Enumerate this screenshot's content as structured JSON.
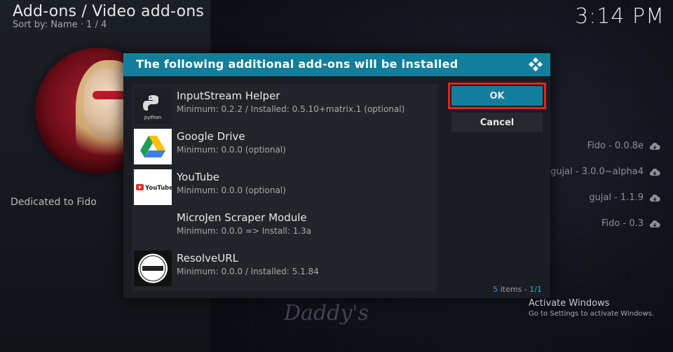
{
  "header": {
    "breadcrumb": "Add-ons / Video add-ons",
    "sort": "Sort by: Name  ·  1 / 4",
    "clock": "3:14 PM"
  },
  "left": {
    "dedicated": "Dedicated to Fido"
  },
  "right_list": [
    {
      "label": "Fido - 0.0.8e"
    },
    {
      "label": "gujal - 3.0.0~alpha4"
    },
    {
      "label": "gujal - 1.1.9"
    },
    {
      "label": "Fido - 0.3"
    }
  ],
  "dialog": {
    "title": "The following additional add-ons will be installed",
    "items": [
      {
        "name": "InputStream Helper",
        "meta": "Minimum: 0.2.2 / Installed: 0.5.10+matrix.1 (optional)",
        "thumb_label": "python"
      },
      {
        "name": "Google Drive",
        "meta": "Minimum: 0.0.0 (optional)"
      },
      {
        "name": "YouTube",
        "meta": "Minimum: 0.0.0 (optional)",
        "thumb_label": "YouTube"
      },
      {
        "name": "MicroJen Scraper Module",
        "meta": "Minimum: 0.0.0 => Install: 1.3a"
      },
      {
        "name": "ResolveURL",
        "meta": "Minimum: 0.0.0 / Installed: 5.1.84"
      }
    ],
    "ok_label": "OK",
    "cancel_label": "Cancel",
    "count_num": "5",
    "count_rest": " items - ",
    "count_page": "1/1"
  },
  "watermark": {
    "line1": "Activate Windows",
    "line2": "Go to Settings to activate Windows."
  },
  "bottom_art_text": "Daddy's",
  "colors": {
    "accent": "#137e9b",
    "highlight_outline": "#e02323",
    "dialog_bg": "#1a1d23"
  }
}
